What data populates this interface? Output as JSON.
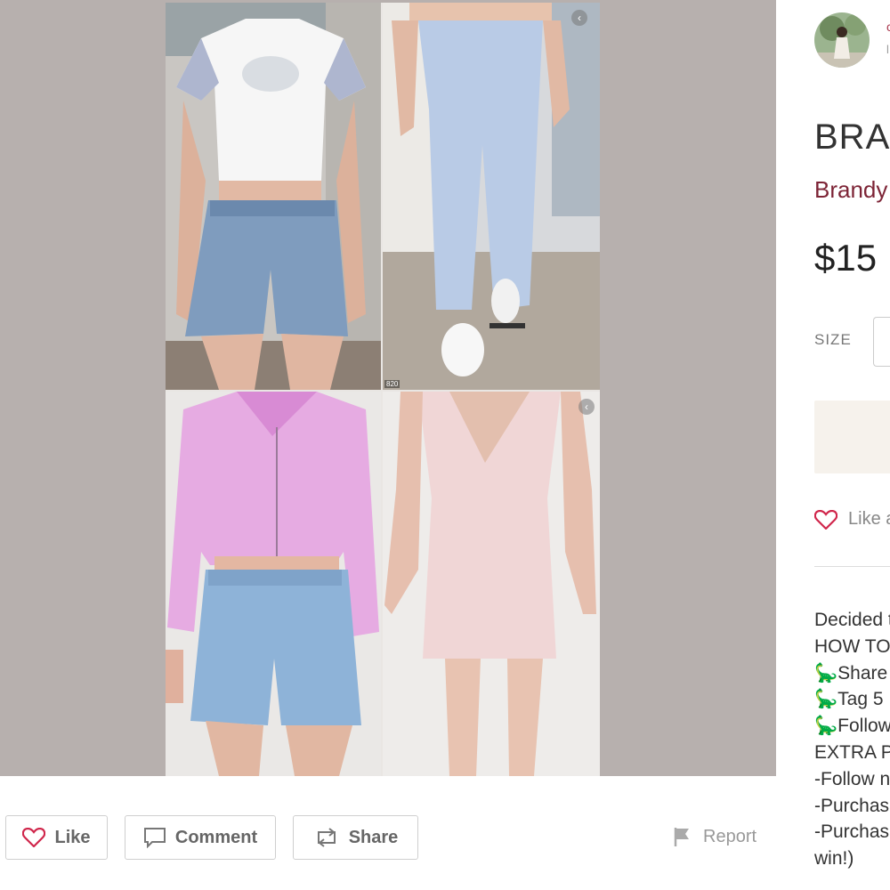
{
  "listing": {
    "title": "BRA",
    "brand": "Brandy",
    "price": "$15",
    "size_label": "SIZE",
    "like_text": "Like a"
  },
  "seller": {
    "name_fragment": "c",
    "sub_fragment": "l"
  },
  "photo": {
    "tag": "820"
  },
  "actions": {
    "like_label": "Like",
    "comment_label": "Comment",
    "share_label": "Share",
    "report_label": "Report"
  },
  "description": [
    "Decided t",
    "HOW TO",
    "🦕Share",
    "🦕Tag 5",
    "🦕Follow",
    "EXTRA P",
    "-Follow n",
    "-Purchas",
    "-Purchas",
    "win!)"
  ],
  "colors": {
    "accent": "#d0264b",
    "brand": "#7d2436",
    "gallery_bg": "#b7b0ae"
  },
  "icons": [
    "heart-icon",
    "comment-icon",
    "share-icon",
    "flag-icon",
    "chevron-left-icon"
  ]
}
